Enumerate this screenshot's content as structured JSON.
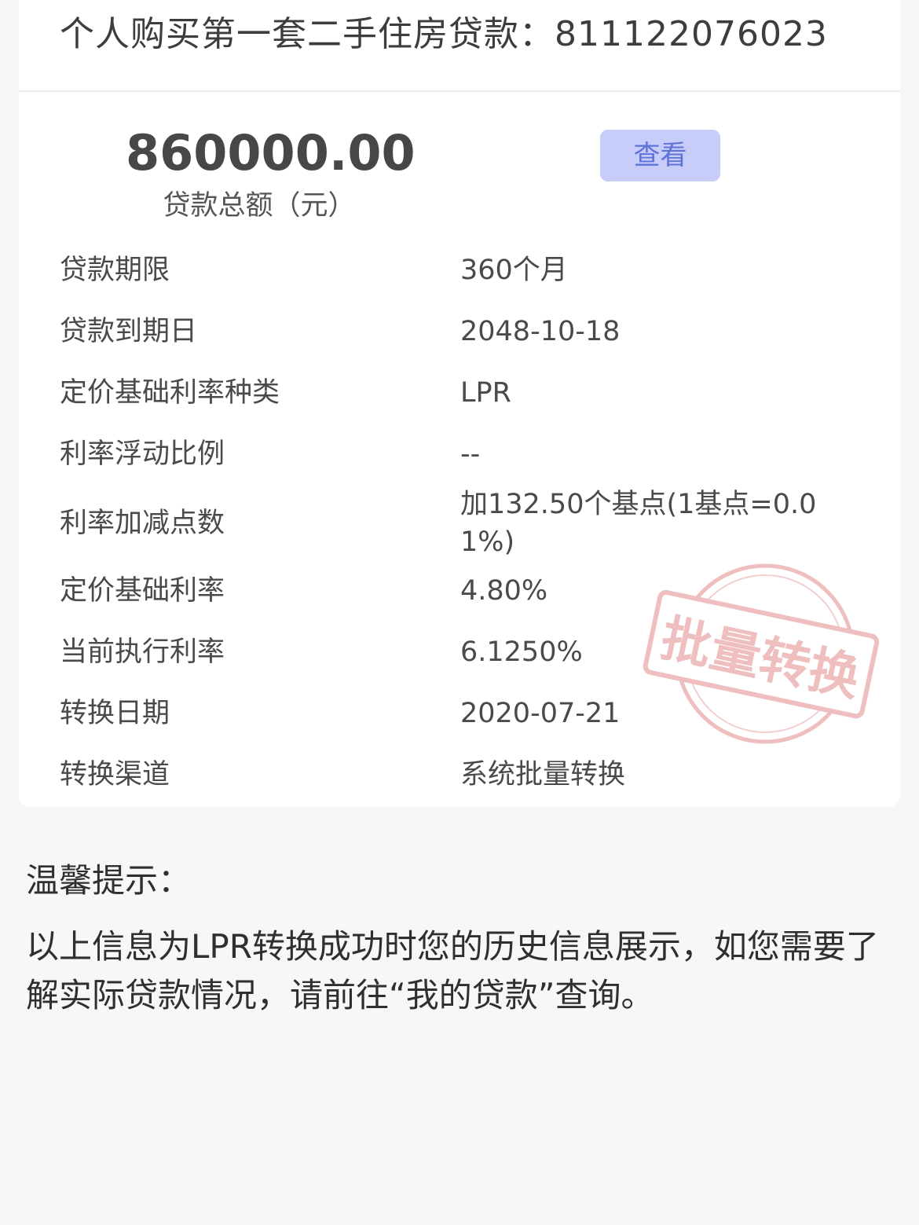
{
  "card": {
    "title": "个人购买第一套二手住房贷款：811122076023",
    "amount": "860000.00",
    "amount_label": "贷款总额（元）",
    "view_button": "查看",
    "rows": [
      {
        "label": "贷款期限",
        "value": "360个月"
      },
      {
        "label": "贷款到期日",
        "value": "2048-10-18"
      },
      {
        "label": "定价基础利率种类",
        "value": "LPR"
      },
      {
        "label": "利率浮动比例",
        "value": "--"
      },
      {
        "label": "利率加减点数",
        "value": "加132.50个基点(1基点=0.01%)"
      },
      {
        "label": "定价基础利率",
        "value": "4.80%"
      },
      {
        "label": "当前执行利率",
        "value": "6.1250%"
      },
      {
        "label": "转换日期",
        "value": "2020-07-21"
      },
      {
        "label": "转换渠道",
        "value": "系统批量转换"
      }
    ],
    "stamp_text": "批量转换"
  },
  "tips": {
    "title": "温馨提示：",
    "body": "以上信息为LPR转换成功时您的历史信息展示，如您需要了解实际贷款情况，请前往“我的贷款”查询。"
  },
  "colors": {
    "page_bg": "#f6f7f9",
    "button_bg": "#c7ccf8",
    "button_text": "#5f72d8",
    "stamp": "#e08080"
  }
}
